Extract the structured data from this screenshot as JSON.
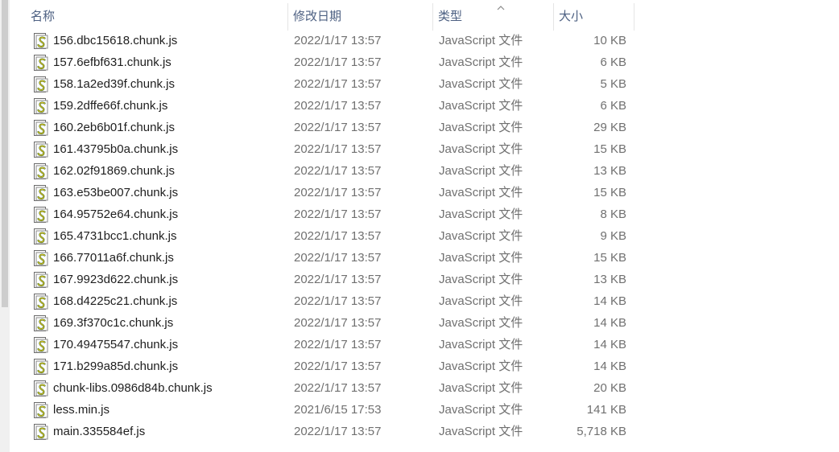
{
  "columns": {
    "name": "名称",
    "modified": "修改日期",
    "type": "类型",
    "size": "大小"
  },
  "files": [
    {
      "name": "156.dbc15618.chunk.js",
      "modified": "2022/1/17 13:57",
      "type": "JavaScript 文件",
      "size": "10 KB",
      "icon": "js-file-icon"
    },
    {
      "name": "157.6efbf631.chunk.js",
      "modified": "2022/1/17 13:57",
      "type": "JavaScript 文件",
      "size": "6 KB",
      "icon": "js-file-icon"
    },
    {
      "name": "158.1a2ed39f.chunk.js",
      "modified": "2022/1/17 13:57",
      "type": "JavaScript 文件",
      "size": "5 KB",
      "icon": "js-file-icon"
    },
    {
      "name": "159.2dffe66f.chunk.js",
      "modified": "2022/1/17 13:57",
      "type": "JavaScript 文件",
      "size": "6 KB",
      "icon": "js-file-icon"
    },
    {
      "name": "160.2eb6b01f.chunk.js",
      "modified": "2022/1/17 13:57",
      "type": "JavaScript 文件",
      "size": "29 KB",
      "icon": "js-file-icon"
    },
    {
      "name": "161.43795b0a.chunk.js",
      "modified": "2022/1/17 13:57",
      "type": "JavaScript 文件",
      "size": "15 KB",
      "icon": "js-file-icon"
    },
    {
      "name": "162.02f91869.chunk.js",
      "modified": "2022/1/17 13:57",
      "type": "JavaScript 文件",
      "size": "13 KB",
      "icon": "js-file-icon"
    },
    {
      "name": "163.e53be007.chunk.js",
      "modified": "2022/1/17 13:57",
      "type": "JavaScript 文件",
      "size": "15 KB",
      "icon": "js-file-icon"
    },
    {
      "name": "164.95752e64.chunk.js",
      "modified": "2022/1/17 13:57",
      "type": "JavaScript 文件",
      "size": "8 KB",
      "icon": "js-file-icon"
    },
    {
      "name": "165.4731bcc1.chunk.js",
      "modified": "2022/1/17 13:57",
      "type": "JavaScript 文件",
      "size": "9 KB",
      "icon": "js-file-icon"
    },
    {
      "name": "166.77011a6f.chunk.js",
      "modified": "2022/1/17 13:57",
      "type": "JavaScript 文件",
      "size": "15 KB",
      "icon": "js-file-icon"
    },
    {
      "name": "167.9923d622.chunk.js",
      "modified": "2022/1/17 13:57",
      "type": "JavaScript 文件",
      "size": "13 KB",
      "icon": "js-file-icon"
    },
    {
      "name": "168.d4225c21.chunk.js",
      "modified": "2022/1/17 13:57",
      "type": "JavaScript 文件",
      "size": "14 KB",
      "icon": "js-file-icon"
    },
    {
      "name": "169.3f370c1c.chunk.js",
      "modified": "2022/1/17 13:57",
      "type": "JavaScript 文件",
      "size": "14 KB",
      "icon": "js-file-icon"
    },
    {
      "name": "170.49475547.chunk.js",
      "modified": "2022/1/17 13:57",
      "type": "JavaScript 文件",
      "size": "14 KB",
      "icon": "js-file-icon"
    },
    {
      "name": "171.b299a85d.chunk.js",
      "modified": "2022/1/17 13:57",
      "type": "JavaScript 文件",
      "size": "14 KB",
      "icon": "js-file-icon"
    },
    {
      "name": "chunk-libs.0986d84b.chunk.js",
      "modified": "2022/1/17 13:57",
      "type": "JavaScript 文件",
      "size": "20 KB",
      "icon": "js-file-icon"
    },
    {
      "name": "less.min.js",
      "modified": "2021/6/15 17:53",
      "type": "JavaScript 文件",
      "size": "141 KB",
      "icon": "js-file-icon"
    },
    {
      "name": "main.335584ef.js",
      "modified": "2022/1/17 13:57",
      "type": "JavaScript 文件",
      "size": "5,718 KB",
      "icon": "js-file-icon"
    }
  ]
}
